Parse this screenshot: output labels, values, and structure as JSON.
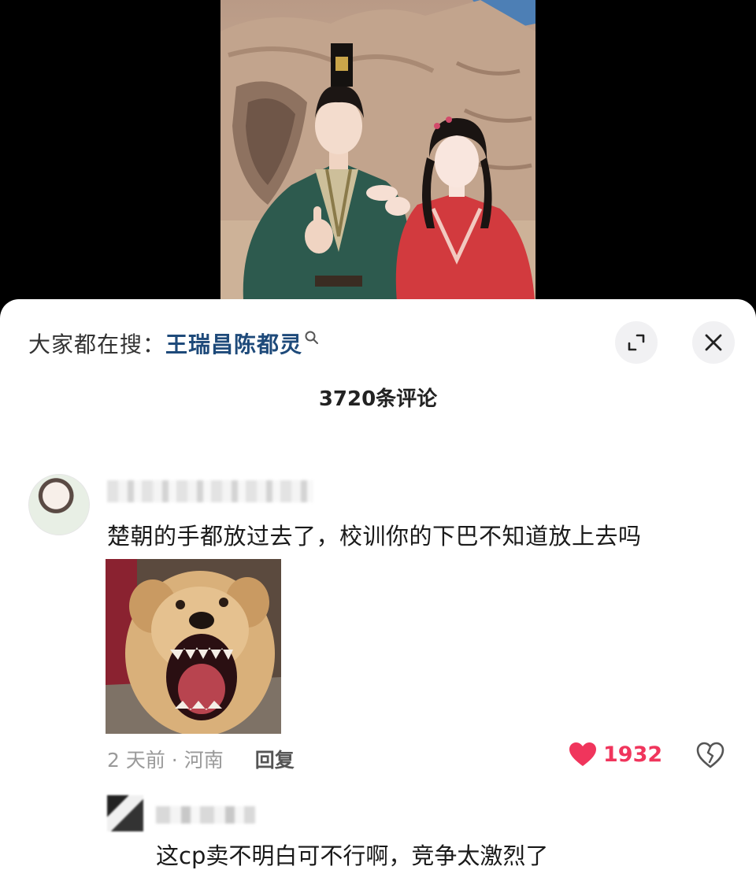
{
  "search": {
    "prefix": "大家都在搜：",
    "term": "王瑞昌陈都灵"
  },
  "comments_header": {
    "count_label": "3720条评论"
  },
  "comments": [
    {
      "text": "楚朝的手都放过去了，校训你的下巴不知道放上去吗",
      "time_location": "2 天前 · 河南",
      "reply_label": "回复",
      "likes": "1932"
    },
    {
      "text": "这cp卖不明白可不行啊，竞争太激烈了"
    }
  ],
  "colors": {
    "like": "#f0355c",
    "search_term": "#1e4a7a",
    "button_bg": "#f1f1f3"
  },
  "icons": [
    "search-icon",
    "expand-icon",
    "close-icon",
    "heart-icon",
    "broken-heart-icon"
  ]
}
